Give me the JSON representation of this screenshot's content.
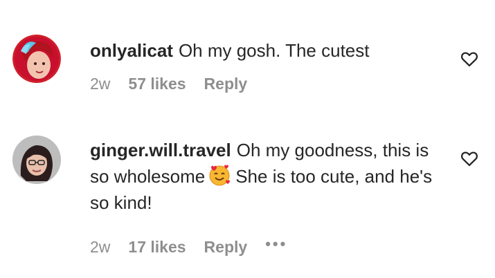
{
  "comments": [
    {
      "username": "onlyalicat",
      "text": "Oh my gosh. The cutest",
      "age": "2w",
      "likes": "57 likes",
      "reply": "Reply"
    },
    {
      "username": "ginger.will.travel",
      "text_before_emoji": "Oh my goodness, this is so wholesome",
      "text_after_emoji": "She is too cute, and he's so kind!",
      "emoji": "smiling-face-with-hearts",
      "age": "2w",
      "likes": "17 likes",
      "reply": "Reply",
      "more": "•••"
    }
  ],
  "colors": {
    "text": "#262626",
    "secondary": "#8e8e8e"
  }
}
